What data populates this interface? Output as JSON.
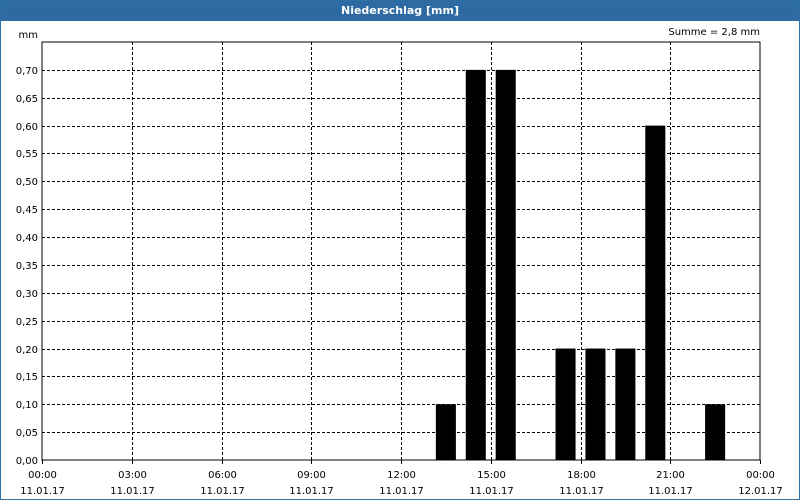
{
  "window": {
    "title": "Niederschlag [mm]"
  },
  "chart_data": {
    "type": "bar",
    "title": "Niederschlag [mm]",
    "ylabel": "mm",
    "annotation": "Summe = 2,8 mm",
    "ylim": [
      0,
      0.75
    ],
    "yticks": [
      "0,00",
      "0,05",
      "0,10",
      "0,15",
      "0,20",
      "0,25",
      "0,30",
      "0,35",
      "0,40",
      "0,45",
      "0,50",
      "0,55",
      "0,60",
      "0,65",
      "0,70"
    ],
    "xticks": [
      {
        "time": "00:00",
        "date": "11.01.17"
      },
      {
        "time": "03:00",
        "date": "11.01.17"
      },
      {
        "time": "06:00",
        "date": "11.01.17"
      },
      {
        "time": "09:00",
        "date": "11.01.17"
      },
      {
        "time": "12:00",
        "date": "11.01.17"
      },
      {
        "time": "15:00",
        "date": "11.01.17"
      },
      {
        "time": "18:00",
        "date": "11.01.17"
      },
      {
        "time": "21:00",
        "date": "11.01.17"
      },
      {
        "time": "00:00",
        "date": "12.01.17"
      }
    ],
    "x_unit": "hour",
    "xlim": [
      0,
      24
    ],
    "bars": [
      {
        "hour": 13,
        "value": 0.1
      },
      {
        "hour": 14,
        "value": 0.7
      },
      {
        "hour": 15,
        "value": 0.7
      },
      {
        "hour": 17,
        "value": 0.2
      },
      {
        "hour": 18,
        "value": 0.2
      },
      {
        "hour": 19,
        "value": 0.2
      },
      {
        "hour": 20,
        "value": 0.6
      },
      {
        "hour": 22,
        "value": 0.1
      }
    ],
    "grid": true,
    "bar_color": "#000000"
  }
}
